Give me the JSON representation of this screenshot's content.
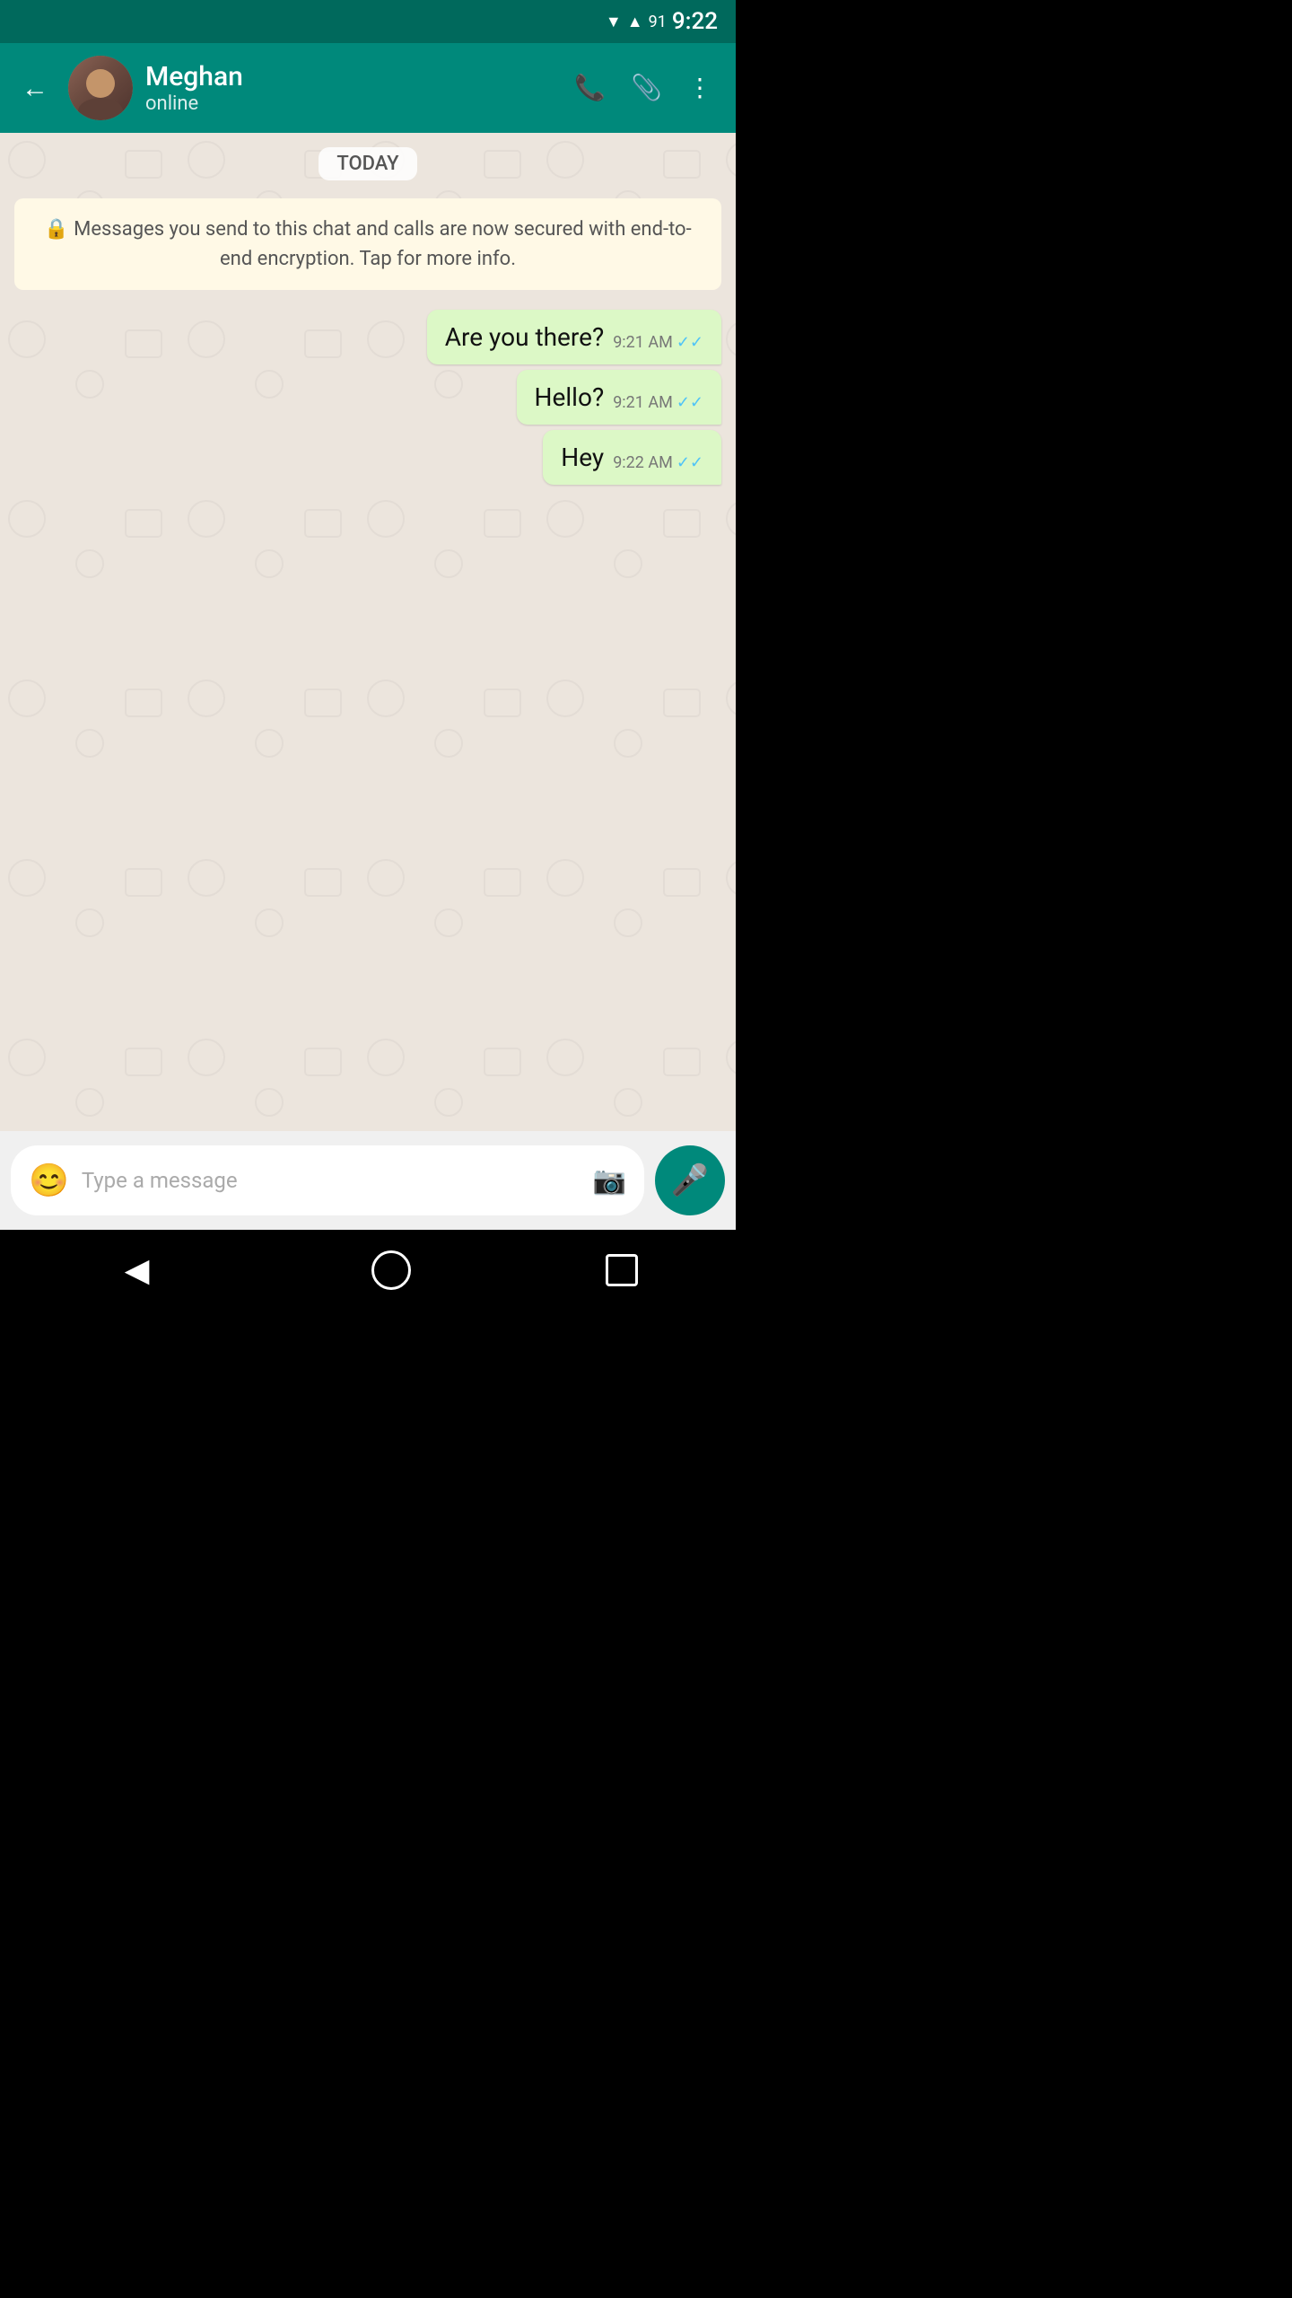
{
  "statusBar": {
    "time": "9:22",
    "batteryLevel": "91"
  },
  "header": {
    "backLabel": "←",
    "contactName": "Meghan",
    "contactStatus": "online",
    "callIcon": "📞",
    "attachIcon": "📎",
    "menuIcon": "⋮"
  },
  "chat": {
    "dateBadge": "TODAY",
    "encryptionNotice": "🔒 Messages you send to this chat and calls are now secured with end-to-end encryption. Tap for more info.",
    "messages": [
      {
        "text": "Are you there?",
        "time": "9:21 AM",
        "ticks": "✓✓"
      },
      {
        "text": "Hello?",
        "time": "9:21 AM",
        "ticks": "✓✓"
      },
      {
        "text": "Hey",
        "time": "9:22 AM",
        "ticks": "✓✓"
      }
    ]
  },
  "inputBar": {
    "placeholder": "Type a message",
    "emojiIcon": "😊",
    "cameraIcon": "📷",
    "micIcon": "🎤"
  },
  "navBar": {
    "backIcon": "◀"
  }
}
